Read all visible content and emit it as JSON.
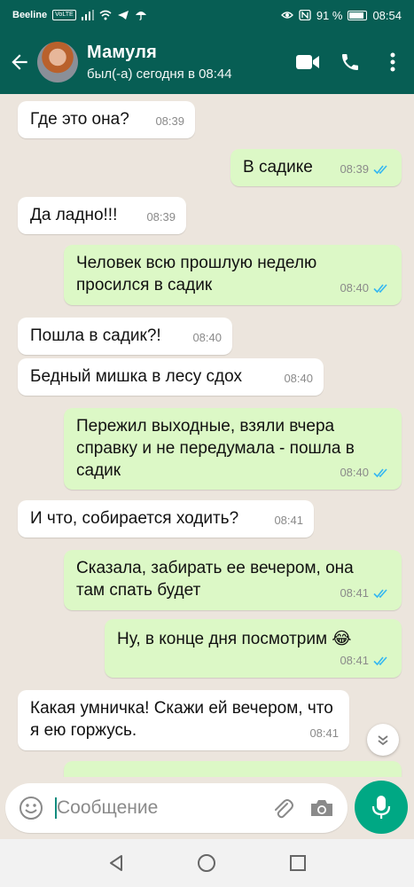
{
  "statusbar": {
    "carrier": "Beeline",
    "network_badge": "VoLTE",
    "battery": "91 %",
    "battery_level": 0.91,
    "clock": "08:54"
  },
  "header": {
    "name": "Мамуля",
    "status": "был(-а) сегодня в 08:44",
    "icons": [
      "back-arrow-icon",
      "video-call-icon",
      "phone-icon",
      "more-icon"
    ]
  },
  "messages": [
    {
      "dir": "in",
      "text": "Где это она?",
      "time": "08:39"
    },
    {
      "dir": "out",
      "text": "В садике",
      "time": "08:39",
      "read": true
    },
    {
      "dir": "in",
      "text": "Да ладно!!!",
      "time": "08:39"
    },
    {
      "dir": "out",
      "text": "Человек всю прошлую неделю просился в садик",
      "time": "08:40",
      "read": true
    },
    {
      "dir": "in",
      "text": "Пошла в садик?!",
      "time": "08:40"
    },
    {
      "dir": "in",
      "text": "Бедный мишка в лесу сдох",
      "time": "08:40"
    },
    {
      "dir": "out",
      "text": "Пережил выходные, взяли вчера справку и не передумала - пошла в садик",
      "time": "08:40",
      "read": true
    },
    {
      "dir": "in",
      "text": "И что, собирается ходить?",
      "time": "08:41"
    },
    {
      "dir": "out",
      "text": "Сказала, забирать ее вечером, она там спать будет",
      "time": "08:41",
      "read": true
    },
    {
      "dir": "out",
      "text": "Ну, в конце дня посмотрим 😂",
      "time": "08:41",
      "read": true
    },
    {
      "dir": "in",
      "text": "Какая умничка! Скажи ей вечером, что я ею горжусь.",
      "time": "08:41"
    }
  ],
  "input": {
    "placeholder": "Сообщение",
    "icons": [
      "emoji-icon",
      "attach-icon",
      "camera-icon",
      "mic-icon"
    ]
  },
  "colors": {
    "header": "#075e54",
    "outgoing": "#dcf8c6",
    "incoming": "#ffffff",
    "read_ticks": "#34b7f1",
    "accent": "#00a884"
  }
}
